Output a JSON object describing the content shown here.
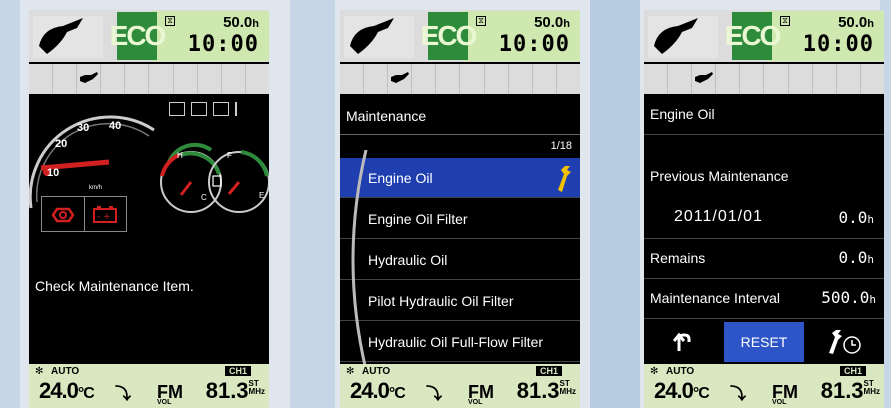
{
  "status": {
    "eco_label": "ECO",
    "hours": "50.0",
    "hours_unit": "h",
    "clock": "10:00"
  },
  "climate": {
    "auto_label": "AUTO",
    "temperature": "24.0",
    "temp_unit": "°C"
  },
  "radio": {
    "band": "FM",
    "frequency": "81.3",
    "stereo": "ST",
    "unit": "MHz",
    "channel": "CH1",
    "vol_label": "VOL"
  },
  "screen1": {
    "speed_ticks": [
      "10",
      "20",
      "30",
      "40"
    ],
    "speed_unit": "km/h",
    "message": "Check Maintenance Item."
  },
  "screen2": {
    "title": "Maintenance",
    "page": "1/18",
    "items": [
      {
        "label": "Engine Oil"
      },
      {
        "label": "Engine Oil Filter"
      },
      {
        "label": "Hydraulic Oil"
      },
      {
        "label": "Pilot Hydraulic Oil Filter"
      },
      {
        "label": "Hydraulic Oil Full-Flow Filter"
      }
    ]
  },
  "screen3": {
    "title": "Engine Oil",
    "previous_label": "Previous Maintenance",
    "previous_date": "2011/01/01",
    "previous_hours": "0.0",
    "remains_label": "Remains",
    "remains_hours": "0.0",
    "interval_label": "Maintenance Interval",
    "interval_hours": "500.0",
    "reset_label": "RESET"
  },
  "colors": {
    "eco": "#2e8b3c",
    "selected": "#1f3fb0",
    "reset": "#2e55c8",
    "warning": "#d12020",
    "lcd": "#d9e8c0"
  }
}
